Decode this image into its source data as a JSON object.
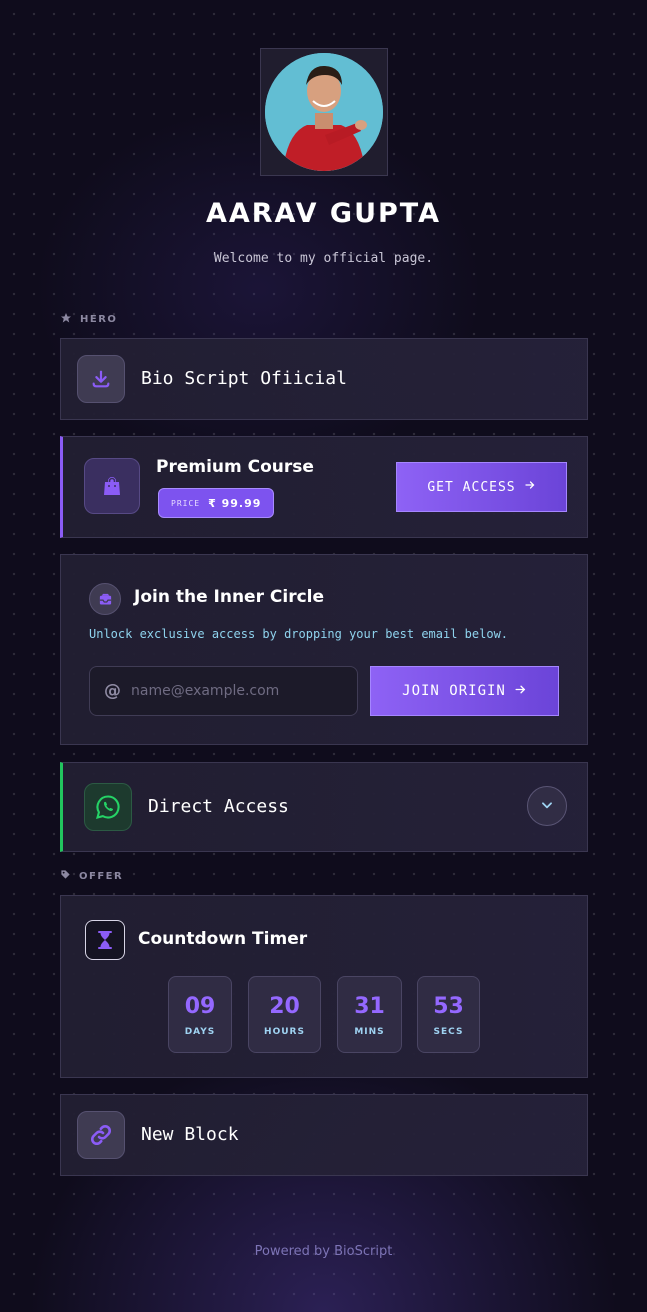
{
  "profile": {
    "name": "AARAV GUPTA",
    "tagline": "Welcome to my official page."
  },
  "sections": {
    "hero_label": "HERO",
    "offer_label": "OFFER"
  },
  "blocks": {
    "bio_script": {
      "title": "Bio Script Ofiicial",
      "icon": "download-icon"
    },
    "premium_course": {
      "title": "Premium Course",
      "price_label": "PRICE",
      "price": "₹ 99.99",
      "button": "GET ACCESS",
      "icon": "shopping-bag-icon"
    },
    "inner_circle": {
      "title": "Join the Inner Circle",
      "description": "Unlock exclusive access by dropping your best email below.",
      "email_placeholder": "name@example.com",
      "button": "JOIN ORIGIN",
      "icon": "inbox-icon"
    },
    "direct_access": {
      "title": "Direct Access",
      "icon": "whatsapp-icon"
    },
    "countdown": {
      "title": "Countdown Timer",
      "icon": "hourglass-icon",
      "units": [
        {
          "value": "09",
          "label": "DAYS"
        },
        {
          "value": "20",
          "label": "HOURS"
        },
        {
          "value": "31",
          "label": "MINS"
        },
        {
          "value": "53",
          "label": "SECS"
        }
      ]
    },
    "new_block": {
      "title": "New Block",
      "icon": "link-icon"
    }
  },
  "footer": {
    "prefix": "Powered by",
    "brand": "BioScript"
  },
  "colors": {
    "accent": "#8b5cf6",
    "whatsapp": "#22c55e",
    "background": "#0f0c1c",
    "card": "#231f35"
  }
}
